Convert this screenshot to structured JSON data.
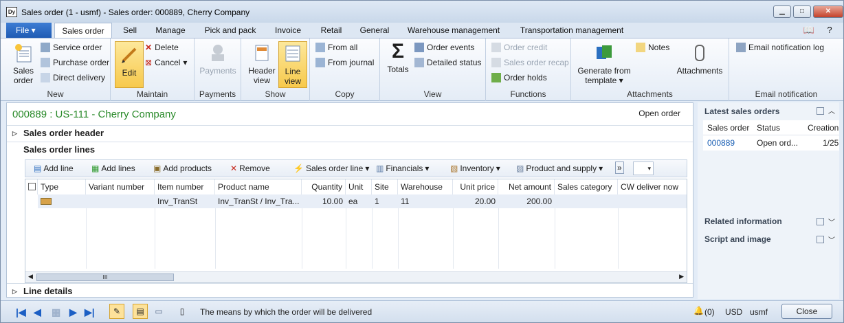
{
  "window": {
    "title": "Sales order (1 - usmf) - Sales order: 000889, Cherry Company",
    "app_icon": "Dy"
  },
  "tabs": [
    "File",
    "Sales order",
    "Sell",
    "Manage",
    "Pick and pack",
    "Invoice",
    "Retail",
    "General",
    "Warehouse management",
    "Transportation management"
  ],
  "ribbon": {
    "new": {
      "label": "New",
      "sales_order": "Sales order",
      "service_order": "Service order",
      "purchase_order": "Purchase order",
      "direct_delivery": "Direct delivery"
    },
    "maintain": {
      "label": "Maintain",
      "edit": "Edit",
      "delete": "Delete",
      "cancel": "Cancel"
    },
    "payments": {
      "label": "Payments",
      "payments": "Payments"
    },
    "show": {
      "label": "Show",
      "header_view": "Header view",
      "line_view": "Line view"
    },
    "copy": {
      "label": "Copy",
      "from_all": "From all",
      "from_journal": "From journal"
    },
    "view": {
      "label": "View",
      "totals": "Totals",
      "order_events": "Order events",
      "detailed_status": "Detailed status"
    },
    "functions": {
      "label": "Functions",
      "order_credit": "Order credit",
      "sales_order_recap": "Sales order recap",
      "order_holds": "Order holds"
    },
    "attachments": {
      "label": "Attachments",
      "generate_from_template": "Generate from template",
      "notes": "Notes",
      "attachments": "Attachments"
    },
    "email": {
      "label": "Email notification",
      "email_log": "Email notification log"
    }
  },
  "header": {
    "title": "000889 : US-111 - Cherry Company",
    "status": "Open order"
  },
  "sections": {
    "header": "Sales order header",
    "lines": "Sales order lines",
    "details": "Line details"
  },
  "lines_toolbar": {
    "add_line": "Add line",
    "add_lines": "Add lines",
    "add_products": "Add products",
    "remove": "Remove",
    "sales_order_line": "Sales order line",
    "financials": "Financials",
    "inventory": "Inventory",
    "product_and_supply": "Product and supply"
  },
  "grid": {
    "columns": [
      "Type",
      "Variant number",
      "Item number",
      "Product name",
      "Quantity",
      "Unit",
      "Site",
      "Warehouse",
      "Unit price",
      "Net amount",
      "Sales category",
      "CW deliver now"
    ],
    "rows": [
      {
        "item": "Inv_TranSt",
        "product": "Inv_TranSt / Inv_Tra...",
        "qty": "10.00",
        "unit": "ea",
        "site": "1",
        "warehouse": "11",
        "price": "20.00",
        "net": "200.00"
      }
    ],
    "scroll_mark": "III"
  },
  "right_panel": {
    "latest": "Latest sales orders",
    "cols": [
      "Sales order",
      "Status",
      "Creation"
    ],
    "row": {
      "order": "000889",
      "status": "Open ord...",
      "date": "1/25"
    },
    "related": "Related information",
    "script": "Script and image"
  },
  "statusbar": {
    "message": "The means by which the order will be delivered",
    "alerts": "(0)",
    "currency": "USD",
    "company": "usmf",
    "close": "Close"
  }
}
